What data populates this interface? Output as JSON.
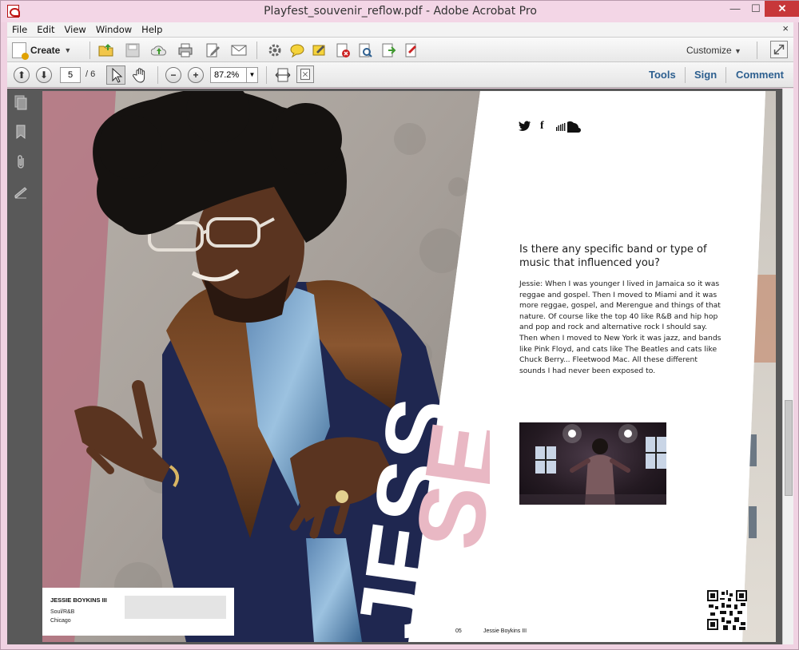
{
  "window": {
    "title": "Playfest_souvenir_reflow.pdf - Adobe Acrobat Pro",
    "min": "—",
    "max": "☐",
    "close": "✕"
  },
  "menu": {
    "items": [
      "File",
      "Edit",
      "View",
      "Window",
      "Help"
    ],
    "close": "×"
  },
  "toolbar": {
    "create_label": "Create",
    "customize_label": "Customize",
    "icons": [
      "open-folder-icon",
      "save-icon",
      "cloud-upload-icon",
      "print-icon",
      "edit-document-icon",
      "email-icon",
      "settings-icon",
      "comment-icon",
      "highlight-icon",
      "pdf-delete-icon",
      "pdf-search-icon",
      "pdf-export-icon",
      "pdf-sign-icon"
    ]
  },
  "nav": {
    "up": "⬆",
    "down": "⬇",
    "page_current": "5",
    "page_total": "/ 6",
    "zoom_out": "−",
    "zoom_in": "+",
    "zoom_value": "87.2%",
    "tabs": [
      "Tools",
      "Sign",
      "Comment"
    ]
  },
  "colors": {
    "accent_link": "#2d5f8f",
    "pink": "#e9b8c4",
    "navy": "#1d2547"
  },
  "document": {
    "social_icons": [
      "twitter-icon",
      "facebook-icon",
      "soundcloud-icon"
    ],
    "social_glyphs": [
      "🐦",
      "f",
      "☁"
    ],
    "question": "Is there any specific band or type of music that influenced you?",
    "answer": "Jessie: When I was younger I lived in Jamaica so it was reggae and gospel. Then I moved to Miami and it was more reggae, gospel, and Merengue and things of that nature. Of course like the top 40 like R&B and hip hop and pop and rock and alternative rock I should say. Then when I moved to New York it was jazz, and bands like Pink Floyd, and cats like The Beatles and cats like Chuck Berry... Fleetwood Mac. All these different sounds I had never been exposed to.",
    "big_word_white": "JESS",
    "big_word_pink": "SE",
    "caption_name": "JESSIE BOYKINS III",
    "caption_genre": "Soul/R&B",
    "caption_city": "Chicago",
    "footer_page": "05",
    "footer_name": "Jessie Boykins III"
  }
}
